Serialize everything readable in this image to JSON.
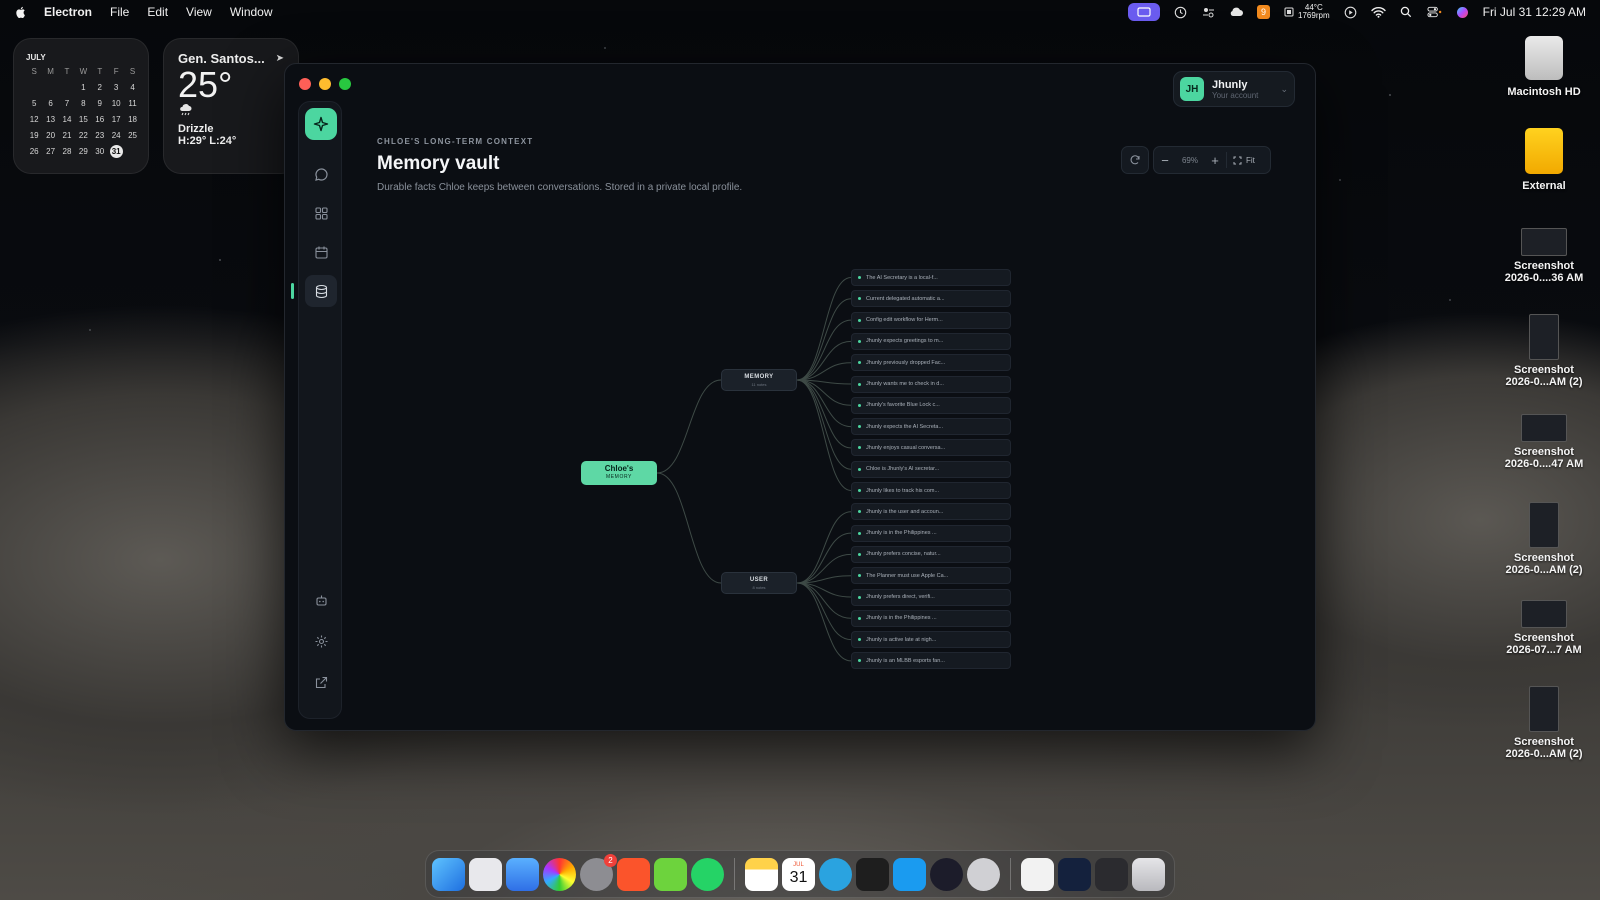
{
  "menubar": {
    "app_name": "Electron",
    "menus": [
      "File",
      "Edit",
      "View",
      "Window"
    ],
    "temp": "44°C",
    "rpm": "1769rpm",
    "badge": "9",
    "clock": "Fri Jul 31  12:29 AM"
  },
  "calendar_widget": {
    "month": "JULY",
    "weekdays": [
      "S",
      "M",
      "T",
      "W",
      "T",
      "F",
      "S"
    ],
    "weeks": [
      [
        "",
        "",
        "",
        "1",
        "2",
        "3",
        "4"
      ],
      [
        "5",
        "6",
        "7",
        "8",
        "9",
        "10",
        "11"
      ],
      [
        "12",
        "13",
        "14",
        "15",
        "16",
        "17",
        "18"
      ],
      [
        "19",
        "20",
        "21",
        "22",
        "23",
        "24",
        "25"
      ],
      [
        "26",
        "27",
        "28",
        "29",
        "30",
        "31",
        ""
      ]
    ],
    "today": "31"
  },
  "weather_widget": {
    "city": "Gen. Santos...",
    "temperature": "25°",
    "condition": "Drizzle",
    "high_low": "H:29° L:24°"
  },
  "desktop": {
    "drives": [
      {
        "label": "Macintosh HD"
      },
      {
        "label": "External"
      }
    ],
    "files": [
      {
        "line1": "Screenshot",
        "line2": "2026-0....36 AM"
      },
      {
        "line1": "Screenshot",
        "line2": "2026-0...AM (2)"
      },
      {
        "line1": "Screenshot",
        "line2": "2026-0....47 AM"
      },
      {
        "line1": "Screenshot",
        "line2": "2026-0...AM (2)"
      },
      {
        "line1": "Screenshot",
        "line2": "2026-07...7 AM"
      },
      {
        "line1": "Screenshot",
        "line2": "2026-0...AM (2)"
      }
    ]
  },
  "account": {
    "initials": "JH",
    "name": "Jhunly",
    "subtitle": "Your account"
  },
  "page": {
    "eyebrow": "CHLOE'S LONG-TERM CONTEXT",
    "title": "Memory vault",
    "subtitle": "Durable facts Chloe keeps between conversations. Stored in a private local profile."
  },
  "toolbar": {
    "zoom": "69%",
    "fit_label": "Fit",
    "zoom_out": "−",
    "zoom_in": "+"
  },
  "graph": {
    "root": {
      "title": "Chloe's",
      "subtitle": "MEMORY"
    },
    "branches": [
      {
        "title": "MEMORY",
        "subtitle": "11 notes"
      },
      {
        "title": "USER",
        "subtitle": "8 notes"
      }
    ],
    "memory_leaves": [
      "The AI Secretary is a local-f...",
      "Current delegated automatic a...",
      "Config edit workflow for Herm...",
      "Jhunly expects greetings to m...",
      "Jhunly previously dropped Fac...",
      "Jhunly wants me to check in d...",
      "Jhunly's favorite Blue Lock c...",
      "Jhunly expects the AI Secreta...",
      "Jhunly enjoys casual conversa...",
      "Chloe is Jhunly's AI secretar...",
      "Jhunly likes to track his com..."
    ],
    "user_leaves": [
      "Jhunly is the user and accoun...",
      "Jhunly is in the Philippines ...",
      "Jhunly prefers concise, natur...",
      "The Planner must use Apple Ca...",
      "Jhunly prefers direct, verifi...",
      "Jhunly is in the Philippines ...",
      "Jhunly is active late at nigh...",
      "Jhunly is an MLBB esports fan..."
    ]
  },
  "dock": {
    "calendar_month": "JUL",
    "calendar_day": "31",
    "settings_badge": "2"
  },
  "colors": {
    "accent": "#4cd6a0",
    "window_bg": "#0b0e13"
  }
}
